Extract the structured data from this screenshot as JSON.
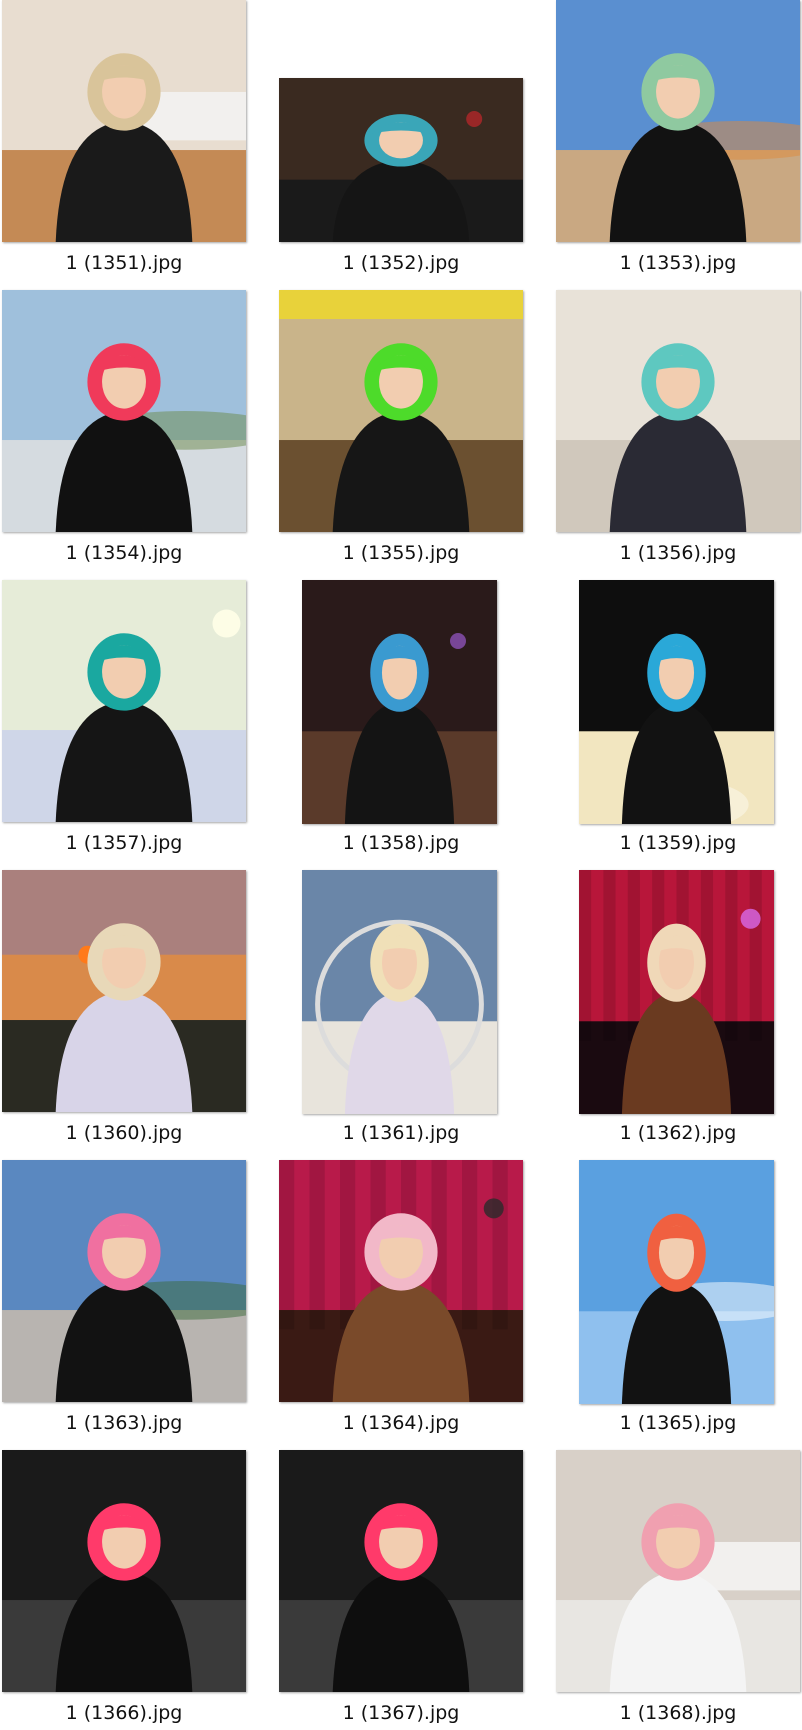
{
  "files": [
    {
      "name": "1 (1351).jpg",
      "orientation": "landscape",
      "scene": "bedroom",
      "colors": {
        "bg": "#e8ddd0",
        "floor": "#c48a55",
        "hair": "#d9c49a",
        "top": "#1a1a1a",
        "accent": "#6d7f8a"
      }
    },
    {
      "name": "1 (1352).jpg",
      "orientation": "landscape",
      "scene": "party",
      "colors": {
        "bg": "#3a2a20",
        "floor": "#1a1a1a",
        "hair": "#3aa6b8",
        "top": "#151515",
        "accent": "#c2262b"
      }
    },
    {
      "name": "1 (1353).jpg",
      "orientation": "landscape",
      "scene": "desert",
      "colors": {
        "bg": "#5a8fd0",
        "floor": "#c9a882",
        "hair": "#8fc9a0",
        "top": "#121212",
        "accent": "#e08a3a"
      }
    },
    {
      "name": "1 (1354).jpg",
      "orientation": "landscape",
      "scene": "rooftop",
      "colors": {
        "bg": "#9fc0dc",
        "floor": "#d5dbe0",
        "hair": "#f03a5a",
        "top": "#111111",
        "accent": "#6b8a4a"
      }
    },
    {
      "name": "1 (1355).jpg",
      "orientation": "landscape",
      "scene": "cafe",
      "colors": {
        "bg": "#c9b48a",
        "floor": "#6b5030",
        "hair": "#4ddb2a",
        "top": "#161616",
        "accent": "#e8d23a"
      }
    },
    {
      "name": "1 (1356).jpg",
      "orientation": "landscape",
      "scene": "singing",
      "colors": {
        "bg": "#e8e2d8",
        "floor": "#d0c8bc",
        "hair": "#5ec8c0",
        "top": "#2a2a34",
        "accent": "#4a8a3a"
      }
    },
    {
      "name": "1 (1357).jpg",
      "orientation": "landscape",
      "scene": "studio",
      "colors": {
        "bg": "#e6ecd8",
        "floor": "#cfd6e8",
        "hair": "#1aa8a0",
        "top": "#151515",
        "accent": "#8a3a1a"
      }
    },
    {
      "name": "1 (1358).jpg",
      "orientation": "portrait",
      "scene": "night-duo",
      "colors": {
        "bg": "#2a1a1a",
        "floor": "#5a3a2a",
        "hair": "#3a9ad0",
        "top": "#141414",
        "accent": "#9a5acd"
      }
    },
    {
      "name": "1 (1359).jpg",
      "orientation": "portrait",
      "scene": "cake",
      "colors": {
        "bg": "#0e0e0e",
        "floor": "#f2e6c0",
        "hair": "#2aa8d8",
        "top": "#121212",
        "accent": "#f7f0d8"
      }
    },
    {
      "name": "1 (1360).jpg",
      "orientation": "landscape",
      "scene": "sunset",
      "colors": {
        "bg": "#d98a4a",
        "floor": "#2a2a22",
        "hair": "#e8d8b8",
        "top": "#d8d4e8",
        "accent": "#ff7a1a"
      }
    },
    {
      "name": "1 (1361).jpg",
      "orientation": "portrait",
      "scene": "bubble-chair",
      "colors": {
        "bg": "#6a86a8",
        "floor": "#e8e4dc",
        "hair": "#f0e0b8",
        "top": "#e0d8e8",
        "accent": "#b8c4d0"
      }
    },
    {
      "name": "1 (1362).jpg",
      "orientation": "portrait",
      "scene": "stage",
      "colors": {
        "bg": "#b8163a",
        "floor": "#1a0a10",
        "hair": "#f0d8b8",
        "top": "#6a3a20",
        "accent": "#d86ae8"
      }
    },
    {
      "name": "1 (1363).jpg",
      "orientation": "landscape",
      "scene": "roof-crouch",
      "colors": {
        "bg": "#5a88c0",
        "floor": "#b8b4b0",
        "hair": "#f070a0",
        "top": "#121212",
        "accent": "#3a6a3a"
      }
    },
    {
      "name": "1 (1364).jpg",
      "orientation": "landscape",
      "scene": "stage-mic",
      "colors": {
        "bg": "#b81a4a",
        "floor": "#3a1a14",
        "hair": "#f2b8c8",
        "top": "#7a4a2a",
        "accent": "#2a2a2a"
      }
    },
    {
      "name": "1 (1365).jpg",
      "orientation": "portrait",
      "scene": "sky",
      "colors": {
        "bg": "#5aa0e0",
        "floor": "#8fc0ee",
        "hair": "#f06040",
        "top": "#121212",
        "accent": "#ffffff"
      }
    },
    {
      "name": "1 (1366).jpg",
      "orientation": "landscape",
      "scene": "pink-portrait",
      "colors": {
        "bg": "#1a1a1a",
        "floor": "#3a3a3a",
        "hair": "#ff3a6a",
        "top": "#0e0e0e",
        "accent": "#f0c8b0"
      }
    },
    {
      "name": "1 (1367).jpg",
      "orientation": "landscape",
      "scene": "pink-smile",
      "colors": {
        "bg": "#1a1a1a",
        "floor": "#3a3a3a",
        "hair": "#ff3a6a",
        "top": "#0e0e0e",
        "accent": "#f0c8b0"
      }
    },
    {
      "name": "1 (1368).jpg",
      "orientation": "landscape",
      "scene": "bed-mirror",
      "colors": {
        "bg": "#d8d0c8",
        "floor": "#e8e6e2",
        "hair": "#f0a0b0",
        "top": "#f4f4f4",
        "accent": "#6a6a70"
      }
    }
  ]
}
